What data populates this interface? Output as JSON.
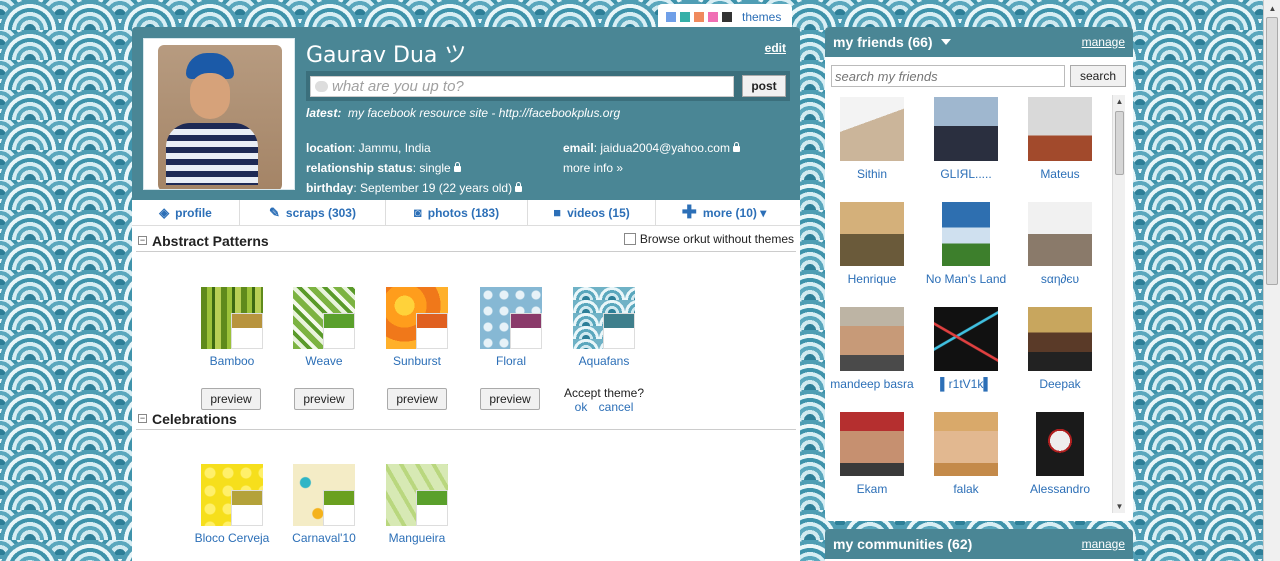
{
  "theme_bar": {
    "swatches": [
      "#6f9fe8",
      "#35b0a8",
      "#f08a5d",
      "#f06fb4",
      "#333333"
    ],
    "link": "themes"
  },
  "profile": {
    "name": "Gaurav Dua ツ",
    "edit": "edit",
    "status_placeholder": "what are you up to?",
    "post_label": "post",
    "latest_label": "latest:",
    "latest_text": "my facebook resource site - http://facebookplus.org",
    "location_label": "location",
    "location_value": ": Jammu, India",
    "relationship_label": "relationship status",
    "relationship_value": ": single",
    "birthday_label": "birthday",
    "birthday_value": ": September 19 (22 years old)",
    "email_label": "email",
    "email_value": ": jaidua2004@yahoo.com",
    "more_info": "more info »"
  },
  "tabs": [
    {
      "label": "profile",
      "icon": "profile-icon"
    },
    {
      "label": "scraps (303)",
      "icon": "scraps-icon"
    },
    {
      "label": "photos (183)",
      "icon": "camera-icon"
    },
    {
      "label": "videos (15)",
      "icon": "video-icon"
    },
    {
      "label": "more (10) ▾",
      "icon": "plus-icon"
    }
  ],
  "theme_sections": [
    {
      "title": "Abstract Patterns",
      "browse_label": "Browse orkut without themes",
      "themes": [
        {
          "name": "Bamboo",
          "accent": "#b8943e"
        },
        {
          "name": "Weave",
          "accent": "#5aa02c"
        },
        {
          "name": "Sunburst",
          "accent": "#e06020"
        },
        {
          "name": "Floral",
          "accent": "#8a3a6a"
        },
        {
          "name": "Aquafans",
          "accent": "#3f7f8c"
        }
      ],
      "preview_label": "preview",
      "accept_label": "Accept theme?",
      "ok_label": "ok",
      "cancel_label": "cancel"
    },
    {
      "title": "Celebrations",
      "themes": [
        {
          "name": "Bloco Cerveja",
          "accent": "#b4a23a"
        },
        {
          "name": "Carnaval'10",
          "accent": "#6aa020"
        },
        {
          "name": "Mangueira",
          "accent": "#5aa02c"
        }
      ]
    }
  ],
  "friends": {
    "title": "my friends (66)",
    "manage": "manage",
    "search_placeholder": "search my friends",
    "search_button": "search",
    "list": [
      {
        "name": "Sithin"
      },
      {
        "name": "GLIЯL....."
      },
      {
        "name": "Mateus"
      },
      {
        "name": "Henrique"
      },
      {
        "name": "No Man's Land"
      },
      {
        "name": "ѕαη∂єυ"
      },
      {
        "name": "mandeep basra"
      },
      {
        "name": "▌r1tV1k▌"
      },
      {
        "name": "Deepak"
      },
      {
        "name": "Ekam"
      },
      {
        "name": "falak"
      },
      {
        "name": "Alessandro"
      }
    ]
  },
  "communities": {
    "title": "my communities (62)",
    "manage": "manage"
  }
}
